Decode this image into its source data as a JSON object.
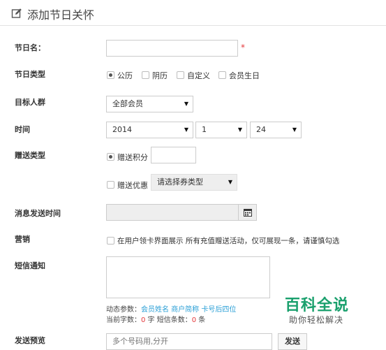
{
  "header": {
    "title": "添加节日关怀",
    "icon": "edit-icon"
  },
  "form": {
    "name": {
      "label": "节日名：",
      "value": "",
      "required_mark": "*"
    },
    "type": {
      "label": "节日类型",
      "options": [
        {
          "label": "公历",
          "selected": true
        },
        {
          "label": "阴历",
          "selected": false
        },
        {
          "label": "自定义",
          "selected": false
        },
        {
          "label": "会员生日",
          "selected": false
        }
      ]
    },
    "target": {
      "label": "目标人群",
      "value": "全部会员"
    },
    "time": {
      "label": "时间",
      "year": "2014",
      "month": "1",
      "day": "24"
    },
    "gift": {
      "label": "赠送类型",
      "points_label": "赠送积分",
      "points_value": "",
      "coupon_label": "赠送优惠",
      "coupon_select": "请选择券类型"
    },
    "send_time": {
      "label": "消息发送时间",
      "value": "",
      "icon": "calendar-icon"
    },
    "marketing": {
      "label": "营销",
      "text": "在用户领卡界面展示 所有充值赠送活动，仅可展现一条，请谨慎勾选"
    },
    "sms": {
      "label": "短信通知",
      "value": "",
      "params_prefix": "动态参数：",
      "params": [
        "会员姓名",
        "商户简称",
        "卡号后四位"
      ],
      "count_prefix": "当前字数：",
      "count_value": "0",
      "count_unit": " 字  短信条数：",
      "sms_count": "0",
      "sms_unit": " 条"
    },
    "preview": {
      "label": "发送预览",
      "placeholder": "多个号码用,分开",
      "button": "发送"
    }
  },
  "watermark": {
    "title": "百科全说",
    "subtitle": "助你轻松解决"
  }
}
